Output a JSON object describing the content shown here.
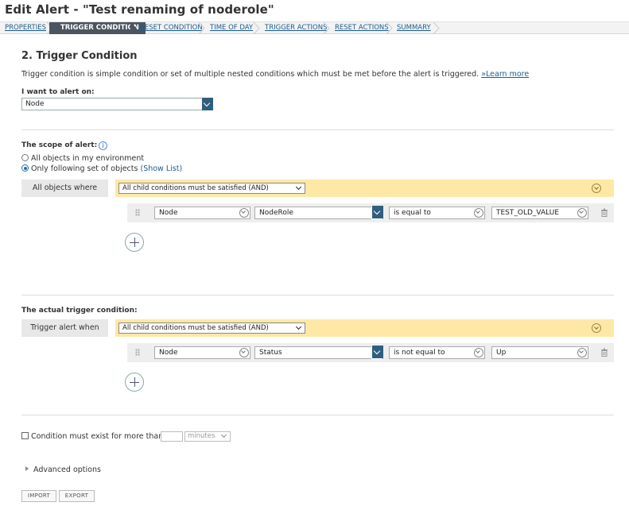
{
  "page": {
    "title": "Edit Alert - \"Test renaming of noderole\""
  },
  "steps": [
    {
      "label": "PROPERTIES",
      "active": false
    },
    {
      "label": "TRIGGER CONDITION",
      "active": true
    },
    {
      "label": "RESET CONDITION",
      "active": false
    },
    {
      "label": "TIME OF DAY",
      "active": false
    },
    {
      "label": "TRIGGER ACTIONS",
      "active": false
    },
    {
      "label": "RESET ACTIONS",
      "active": false
    },
    {
      "label": "SUMMARY",
      "active": false
    }
  ],
  "section": {
    "title": "2. Trigger Condition",
    "description": "Trigger condition is simple condition or set of multiple nested conditions which must be met before the alert is triggered.",
    "learn_more": "»Learn more"
  },
  "alert_on": {
    "label": "I want to alert on:",
    "value": "Node"
  },
  "scope": {
    "label": "The scope of alert:",
    "options": [
      {
        "label": "All objects in my environment",
        "selected": false
      },
      {
        "label": "Only following set of objects",
        "selected": true
      }
    ],
    "show_list": "(Show List)",
    "row_label": "All objects where",
    "logic": "All child conditions must be satisfied (AND)",
    "rule": {
      "object": "Node",
      "field": "NodeRole",
      "operator": "is equal to",
      "value": "TEST_OLD_VALUE"
    }
  },
  "trigger": {
    "label": "The actual trigger condition:",
    "row_label": "Trigger alert when",
    "logic": "All child conditions must be satisfied (AND)",
    "rule": {
      "object": "Node",
      "field": "Status",
      "operator": "is not equal to",
      "value": "Up"
    }
  },
  "duration": {
    "label": "Condition must exist for more than",
    "value": "",
    "unit": "minutes"
  },
  "advanced": {
    "label": "Advanced options"
  },
  "buttons": {
    "import": "IMPORT",
    "export": "EXPORT"
  },
  "colors": {
    "logic_bar": "#fde8a6",
    "active_step": "#4b5560",
    "link": "#1d5d8f"
  }
}
